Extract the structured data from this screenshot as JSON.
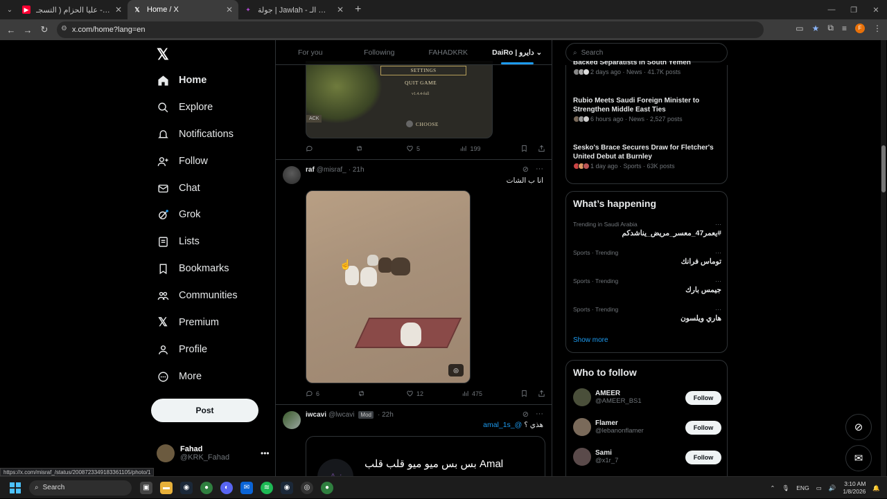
{
  "browser": {
    "tabs": [
      {
        "title": "ماجد العازمي - عليا الحزام ( التسجـ",
        "active": false,
        "favicon": "youtube-icon",
        "color": "#ff0033"
      },
      {
        "title": "Home / X",
        "active": true,
        "favicon": "x-icon",
        "color": "#ffffff"
      },
      {
        "title": "جولة | Jawlah - منصة الألعاب الـ",
        "active": false,
        "favicon": "jawlah-icon",
        "color": "#b04ad0"
      }
    ],
    "url": "x.com/home?lang=en"
  },
  "nav": {
    "items": [
      {
        "label": "Home",
        "icon": "home-icon"
      },
      {
        "label": "Explore",
        "icon": "search-icon"
      },
      {
        "label": "Notifications",
        "icon": "bell-icon"
      },
      {
        "label": "Follow",
        "icon": "person-add-icon"
      },
      {
        "label": "Chat",
        "icon": "mail-icon"
      },
      {
        "label": "Grok",
        "icon": "grok-icon"
      },
      {
        "label": "Lists",
        "icon": "list-icon"
      },
      {
        "label": "Bookmarks",
        "icon": "bookmark-icon"
      },
      {
        "label": "Communities",
        "icon": "communities-icon"
      },
      {
        "label": "Premium",
        "icon": "x-icon"
      },
      {
        "label": "Profile",
        "icon": "person-icon"
      },
      {
        "label": "More",
        "icon": "more-icon"
      }
    ],
    "post_label": "Post",
    "me": {
      "name": "Fahad",
      "handle": "@KRK_Fahad"
    }
  },
  "feed_tabs": [
    "For you",
    "Following",
    "FAHADKRK",
    "DaiRo | دايرو"
  ],
  "post1": {
    "image_text": {
      "settings": "SETTINGS",
      "quit": "QUIT GAME",
      "version": "v1.4.4-full",
      "back": "ACK",
      "choose": "CHOOSE"
    },
    "replies": "",
    "reposts": "",
    "likes": "5",
    "views": "199"
  },
  "post2": {
    "name": "raf",
    "handle": "@misraf_",
    "time": "· 21h",
    "text": "انا ب الشات",
    "replies": "6",
    "reposts": "",
    "likes": "12",
    "views": "475"
  },
  "post3": {
    "name": "iwcavi",
    "handle": "@lwcavi",
    "badge": "Mod",
    "time": "· 22h",
    "mention": "@_amal_1s",
    "text": "هذي ؟",
    "quote_text": "بس بس ميو ميو قلب قلب Amal",
    "quote_avatar": "A𝒿"
  },
  "search_placeholder": "Search",
  "news": [
    {
      "title": "Backed Separatists in South Yemen",
      "meta": "2 days ago · News · 41.7K posts"
    },
    {
      "title": "Rubio Meets Saudi Foreign Minister to Strengthen Middle East Ties",
      "meta": "6 hours ago · News · 2,527 posts"
    },
    {
      "title": "Sesko's Brace Secures Draw for Fletcher's United Debut at Burnley",
      "meta": "1 day ago · Sports · 63K posts"
    }
  ],
  "happening": {
    "title": "What’s happening",
    "trends": [
      {
        "category": "Trending in Saudi Arabia",
        "name": "#يعمر47_معسر_مريض_يناشدكم"
      },
      {
        "category": "Sports · Trending",
        "name": "توماس فرانك"
      },
      {
        "category": "Sports · Trending",
        "name": "جيمس بارك"
      },
      {
        "category": "Sports · Trending",
        "name": "هاري ويلسون"
      }
    ],
    "show_more": "Show more"
  },
  "who_to_follow": {
    "title": "Who to follow",
    "users": [
      {
        "name": "AMEER",
        "handle": "@AMEER_BS1",
        "button": "Follow",
        "color": "#4a4f3a"
      },
      {
        "name": "Flamer",
        "handle": "@lebanonflamer",
        "button": "Follow",
        "color": "#7a6a5a"
      },
      {
        "name": "Sami",
        "handle": "@x1r_7",
        "button": "Follow",
        "color": "#5a4a4a"
      }
    ]
  },
  "status_url": "https://x.com/misraf_/status/2008723349183361105/photo/1",
  "taskbar": {
    "search": "Search",
    "lang": "ENG",
    "time": "3:10 AM",
    "date": "1/8/2026"
  }
}
